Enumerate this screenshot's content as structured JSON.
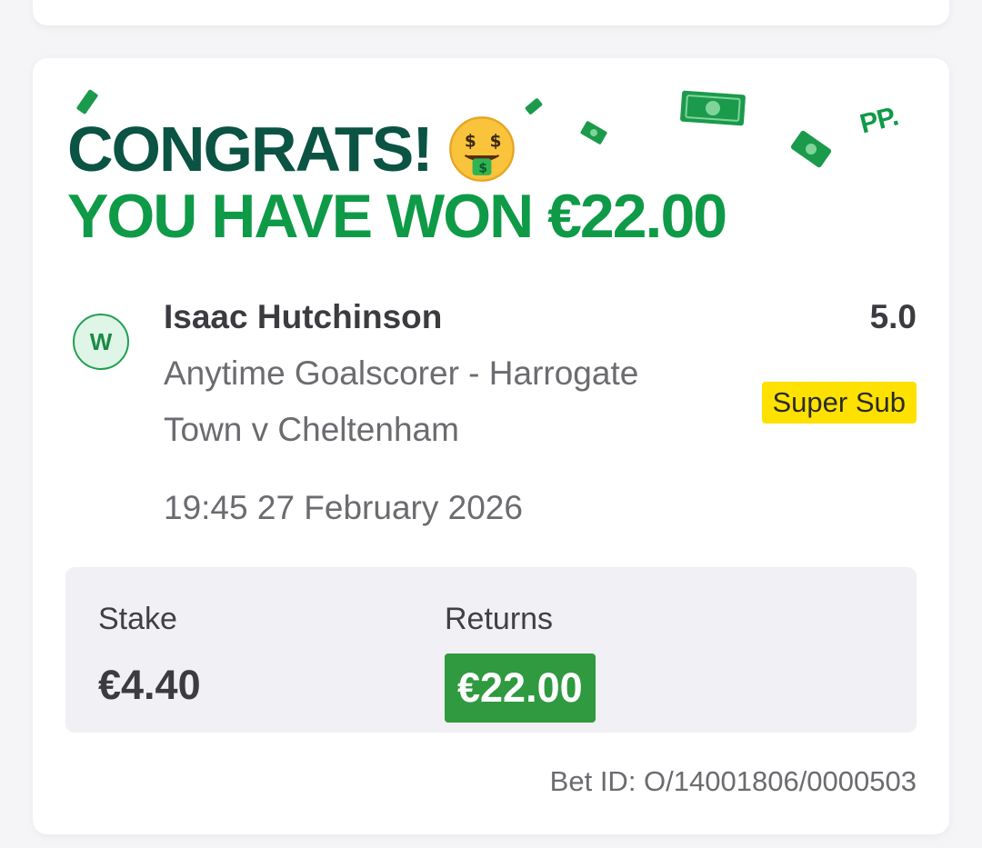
{
  "header": {
    "congrats": "CONGRATS!",
    "won_text": "YOU HAVE WON €22.00",
    "emoji_icon": "money-mouth-face-icon",
    "logo": "PP."
  },
  "selection": {
    "result_badge": "W",
    "name": "Isaac Hutchinson",
    "market_line1": "Anytime Goalscorer - Harrogate",
    "market_line2": "Town v Cheltenham",
    "datetime": "19:45 27 February 2026",
    "odds": "5.0",
    "tag": "Super Sub"
  },
  "summary": {
    "stake_label": "Stake",
    "stake_value": "€4.40",
    "returns_label": "Returns",
    "returns_value": "€22.00"
  },
  "footer": {
    "bet_id": "Bet ID: O/14001806/0000503"
  },
  "colors": {
    "brand_dark_green": "#0b5343",
    "brand_green": "#0e9a47",
    "returns_green": "#2f9a3f",
    "super_sub_yellow": "#ffe100"
  }
}
